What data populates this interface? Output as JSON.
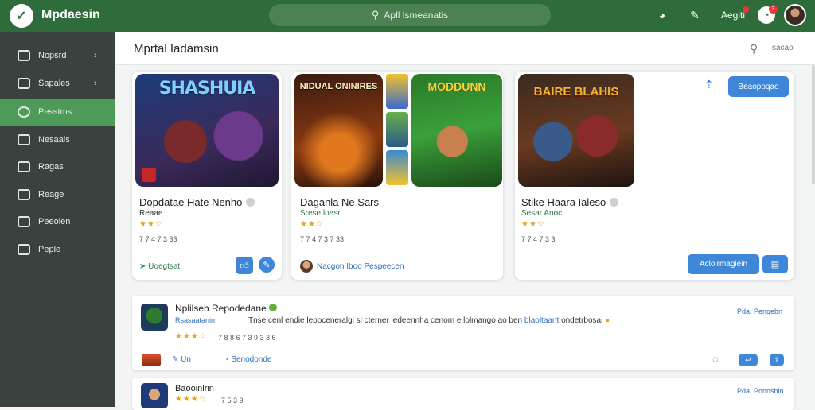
{
  "app": {
    "name": "Mpdaesin"
  },
  "search": {
    "placeholder": "Apll lsmeanatis"
  },
  "topbar": {
    "user_label": "Aegiti",
    "bell_count": "3"
  },
  "sidebar": {
    "items": [
      {
        "label": "Nopsrd",
        "has_chevron": true
      },
      {
        "label": "Sapales",
        "has_chevron": true
      },
      {
        "label": "Pesstms",
        "active": true
      },
      {
        "label": "Nesaals"
      },
      {
        "label": "Ragas"
      },
      {
        "label": "Reage"
      },
      {
        "label": "Peeoien"
      },
      {
        "label": "Peple"
      }
    ]
  },
  "page": {
    "title": "Mprtal Iadamsin",
    "more_label": "sacao"
  },
  "featured": [
    {
      "art_title": "SHASHUIA",
      "title": "Dopdatae Hate Nenho",
      "sub": "Reaae",
      "stars": "★★☆",
      "meta": "7 7 4  7 3  33",
      "action_label": "Uoegtsat"
    },
    {
      "art_title": "NIDUAL ONINIRES",
      "art_title_2": "MODDUNN",
      "title": "Daganla Ne Sars",
      "sub": "Srese loesr",
      "stars": "★★☆",
      "meta": "7 7 4  7 3  7 33",
      "action_label": "Nacgon Iboo Pespeecen"
    },
    {
      "art_title": "BAIRE BLAHIS",
      "title": "Stike Haara Ialeso",
      "sub": "Sesar Anoc",
      "stars": "★★☆",
      "meta": "7 7 4  7 3  3",
      "top_button_label": "Beaopoqao",
      "bottom_button_label": "Acloirmagiein"
    }
  ],
  "list": [
    {
      "title": "Nplilseh Repodedane",
      "sub": "Rsasaatanin",
      "description": "Tnse cenl endie lepoceneralgl sl cterner ledeennha cenom e lolmango ao ben",
      "description_link": "blaoltaant",
      "description_tail": "ondetrbosai",
      "stars": "★★★☆",
      "meta": "7 8 8 6  7 3 9  3 3 6",
      "action_1": "Un",
      "action_2": "Senodonde",
      "right_label": "Pda. Pengebn"
    },
    {
      "title": "Baooinlrin",
      "stars": "★★★☆",
      "meta": "7 5 3 9",
      "right_label": "Pda. Ponnsbin"
    }
  ],
  "colors": {
    "brand_green": "#2e6c3c",
    "active_green": "#4e9a58",
    "accent_blue": "#3d86d8",
    "star": "#e2a521"
  }
}
